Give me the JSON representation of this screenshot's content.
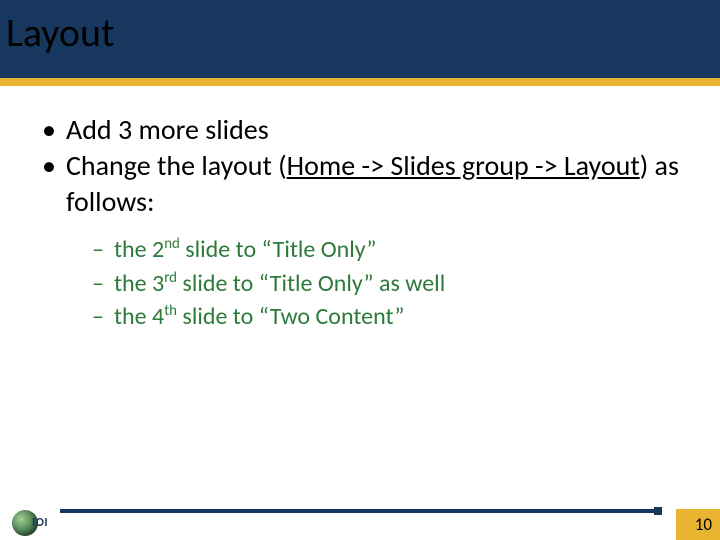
{
  "title": "Layout",
  "bullets": [
    {
      "prefix": "Add 3 more slides",
      "mid": "",
      "suffix": ""
    }
  ],
  "bullet2": {
    "p1": "Change the layout (",
    "u": "Home -> Slides group -> Layout",
    "p2": ") as follows:"
  },
  "sub": [
    {
      "a": "the 2",
      "ord": "nd",
      "b": " slide to “Title Only”"
    },
    {
      "a": "the 3",
      "ord": "rd",
      "b": " slide to “Title Only” as well"
    },
    {
      "a": "the 4",
      "ord": "th",
      "b": " slide to “Two Content”"
    }
  ],
  "page_number": "10",
  "logo_text": "IOI"
}
